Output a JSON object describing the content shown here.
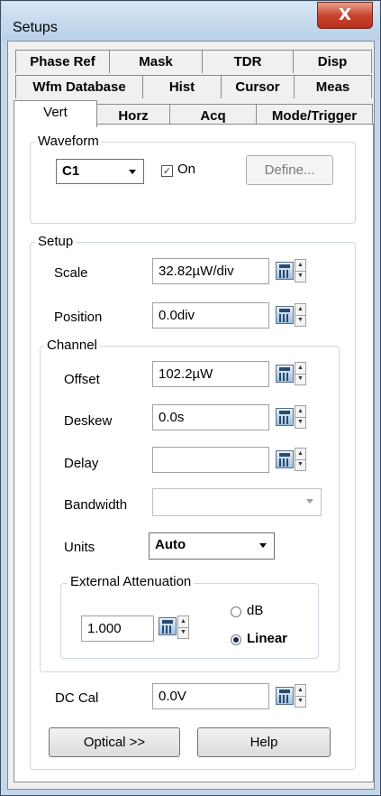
{
  "window": {
    "title": "Setups",
    "close_label": "X"
  },
  "tabs": {
    "row1": [
      "Phase Ref",
      "Mask",
      "TDR",
      "Disp"
    ],
    "row2": [
      "Wfm Database",
      "Hist",
      "Cursor",
      "Meas"
    ],
    "row3": [
      "Vert",
      "Horz",
      "Acq",
      "Mode/Trigger"
    ],
    "active": "Vert"
  },
  "waveform": {
    "group_label": "Waveform",
    "channel_selected": "C1",
    "on_label": "On",
    "on_checked": true,
    "define_label": "Define..."
  },
  "setup": {
    "group_label": "Setup",
    "scale_label": "Scale",
    "scale_value": "32.82µW/div",
    "position_label": "Position",
    "position_value": "0.0div"
  },
  "channel": {
    "group_label": "Channel",
    "offset_label": "Offset",
    "offset_value": "102.2µW",
    "deskew_label": "Deskew",
    "deskew_value": "0.0s",
    "delay_label": "Delay",
    "delay_value": "",
    "bandwidth_label": "Bandwidth",
    "bandwidth_value": "",
    "units_label": "Units",
    "units_selected": "Auto"
  },
  "external_attenuation": {
    "group_label": "External Attenuation",
    "value": "1.000",
    "db_label": "dB",
    "linear_label": "Linear",
    "selected": "Linear"
  },
  "dc_cal": {
    "label": "DC Cal",
    "value": "0.0V"
  },
  "buttons": {
    "optical_label": "Optical >>",
    "help_label": "Help"
  },
  "icons": {
    "calculator": "calculator-icon",
    "spin_up": "spin-up-icon",
    "spin_down": "spin-down-icon",
    "dropdown": "chevron-down-icon",
    "close": "close-icon"
  }
}
